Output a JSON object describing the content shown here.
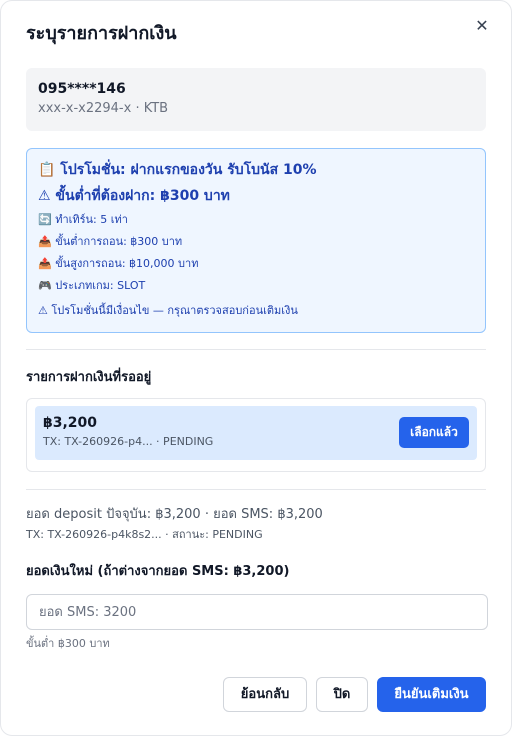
{
  "dialog": {
    "title": "ระบุรายการฝากเงิน",
    "close_icon": "✕"
  },
  "account": {
    "phone": "095****146",
    "bank_line": "xxx-x-x2294-x · KTB"
  },
  "promotion": {
    "title": "📋 โปรโมชั่น: ฝากแรกของวัน รับโบนัส 10%",
    "min_deposit": "⚠ ขั้นต่ำที่ต้องฝาก: ฿300 บาท",
    "turnover": "🔄 ทำเทิร์น: 5 เท่า",
    "min_withdraw": "📤 ขั้นต่ำการถอน: ฿300 บาท",
    "max_withdraw": "📤 ขั้นสูงการถอน: ฿10,000 บาท",
    "game_type": "🎮 ประเภทเกม: SLOT",
    "note": "⚠ โปรโมชั่นนี้มีเงื่อนไข — กรุณาตรวจสอบก่อนเติมเงิน"
  },
  "pending": {
    "label": "รายการฝากเงินที่รออยู่",
    "items": [
      {
        "amount": "฿3,200",
        "meta": "TX: TX-260926-p4... · PENDING",
        "select_label": "เลือกแล้ว"
      }
    ]
  },
  "summary": {
    "line": "ยอด deposit ปัจจุบัน: ฿3,200 · ยอด SMS: ฿3,200",
    "sub": "TX: TX-260926-p4k8s2... · สถานะ: PENDING"
  },
  "new_amount": {
    "label": "ยอดเงินใหม่ (ถ้าต่างจากยอด SMS: ฿3,200)",
    "placeholder": "ยอด SMS: 3200",
    "value": "",
    "min_hint": "ขั้นต่ำ ฿300 บาท"
  },
  "footer": {
    "back_label": "ย้อนกลับ",
    "close_label": "ปิด",
    "confirm_label": "ยืนยันเติมเงิน"
  },
  "colors": {
    "primary": "#2563eb",
    "promo_text": "#1e40af",
    "promo_bg": "#eff6ff",
    "promo_border": "#93c5fd",
    "pending_bg": "#dbeafe"
  }
}
